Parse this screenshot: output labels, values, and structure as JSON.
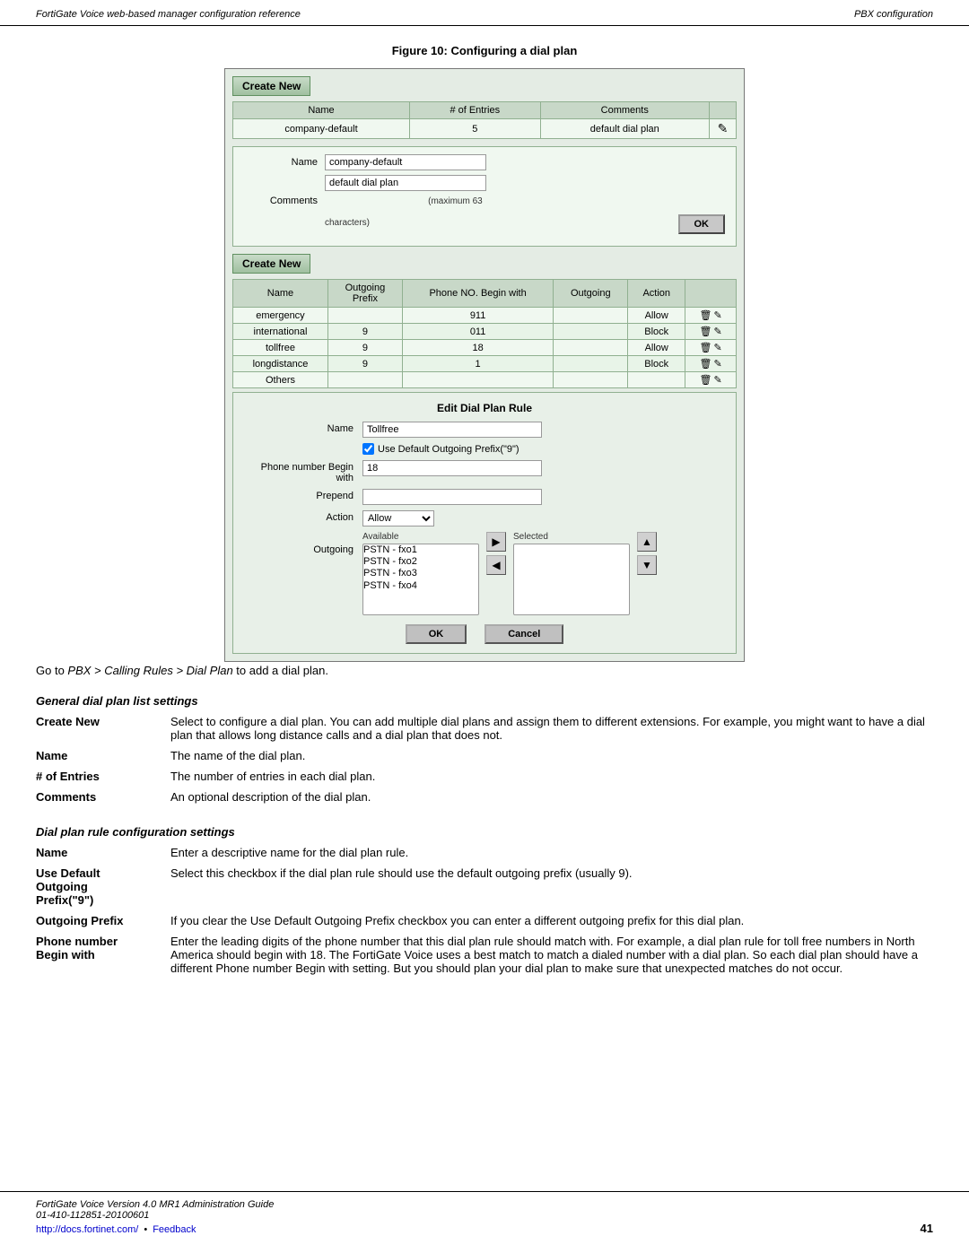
{
  "header": {
    "left": "FortiGate Voice web-based manager configuration reference",
    "right": "PBX configuration"
  },
  "footer": {
    "left": "FortiGate Voice Version 4.0 MR1 Administration Guide",
    "left2": "01-410-112851-20100601",
    "link": "http://docs.fortinet.com/",
    "feedback": "Feedback",
    "page_number": "41"
  },
  "figure": {
    "title": "Figure 10: Configuring a dial plan"
  },
  "ui": {
    "create_new_label": "Create New",
    "table1": {
      "headers": [
        "Name",
        "# of Entries",
        "Comments"
      ],
      "rows": [
        [
          "company-default",
          "5",
          "default dial plan"
        ]
      ]
    },
    "form1": {
      "name_label": "Name",
      "name_value": "company-default",
      "comments_label": "Comments",
      "comments_value": "default dial plan",
      "max_note": "(maximum 63",
      "chars_note": "characters)",
      "ok_label": "OK"
    },
    "table2": {
      "headers": [
        "Name",
        "Outgoing Prefix",
        "Phone NO. Begin with",
        "Outgoing",
        "Action"
      ],
      "rows": [
        [
          "emergency",
          "",
          "911",
          "",
          "Allow"
        ],
        [
          "international",
          "9",
          "011",
          "",
          "Block"
        ],
        [
          "tollfree",
          "9",
          "18",
          "",
          "Allow"
        ],
        [
          "longdistance",
          "9",
          "1",
          "",
          "Block"
        ],
        [
          "Others",
          "",
          "",
          "",
          ""
        ]
      ]
    },
    "edit_panel": {
      "title": "Edit Dial Plan Rule",
      "name_label": "Name",
      "name_value": "Tollfree",
      "use_default_label": "Use Default Outgoing Prefix(\"9\")",
      "phone_begin_label": "Phone number Begin with",
      "phone_begin_value": "18",
      "prepend_label": "Prepend",
      "prepend_value": "",
      "action_label": "Action",
      "action_value": "Allow",
      "outgoing_label": "Outgoing",
      "available_label": "Available",
      "selected_label": "Selected",
      "available_items": [
        "PSTN - fxo1",
        "PSTN - fxo2",
        "PSTN - fxo3",
        "PSTN - fxo4"
      ],
      "selected_items": [],
      "ok_label": "OK",
      "cancel_label": "Cancel"
    }
  },
  "doc": {
    "goto_text": "Go to ",
    "goto_italic": "PBX > Calling Rules > Dial Plan",
    "goto_suffix": " to add a dial plan.",
    "section1_title": "General dial plan list settings",
    "terms1": [
      {
        "term": "Create New",
        "desc": "Select to configure a dial plan. You can add multiple dial plans and assign them to different extensions. For example, you might want to have a dial plan that allows long distance calls and a dial plan that does not."
      },
      {
        "term": "Name",
        "desc": "The name of the dial plan."
      },
      {
        "term": "# of Entries",
        "desc": "The number of entries in each dial plan."
      },
      {
        "term": "Comments",
        "desc": "An optional description of the dial plan."
      }
    ],
    "section2_title": "Dial plan rule configuration settings",
    "terms2": [
      {
        "term": "Name",
        "desc": "Enter a descriptive name for the dial plan rule."
      },
      {
        "term": "Use Default\nOutgoing\nPrefix(\"9\")",
        "desc": "Select this checkbox if the dial plan rule should use the default outgoing prefix (usually 9)."
      },
      {
        "term": "Outgoing Prefix",
        "desc": "If you clear the Use Default Outgoing Prefix checkbox you can enter a different outgoing prefix for this dial plan."
      },
      {
        "term": "Phone number\nBegin with",
        "desc": "Enter the leading digits of the phone number that this dial plan rule should match with. For example, a dial plan rule for toll free numbers in North America should begin with 18. The FortiGate Voice uses a best match to match a dialed number with a dial plan. So each dial plan should have a different Phone number Begin with setting. But you should plan your dial plan to make sure that unexpected matches do not occur."
      }
    ]
  }
}
